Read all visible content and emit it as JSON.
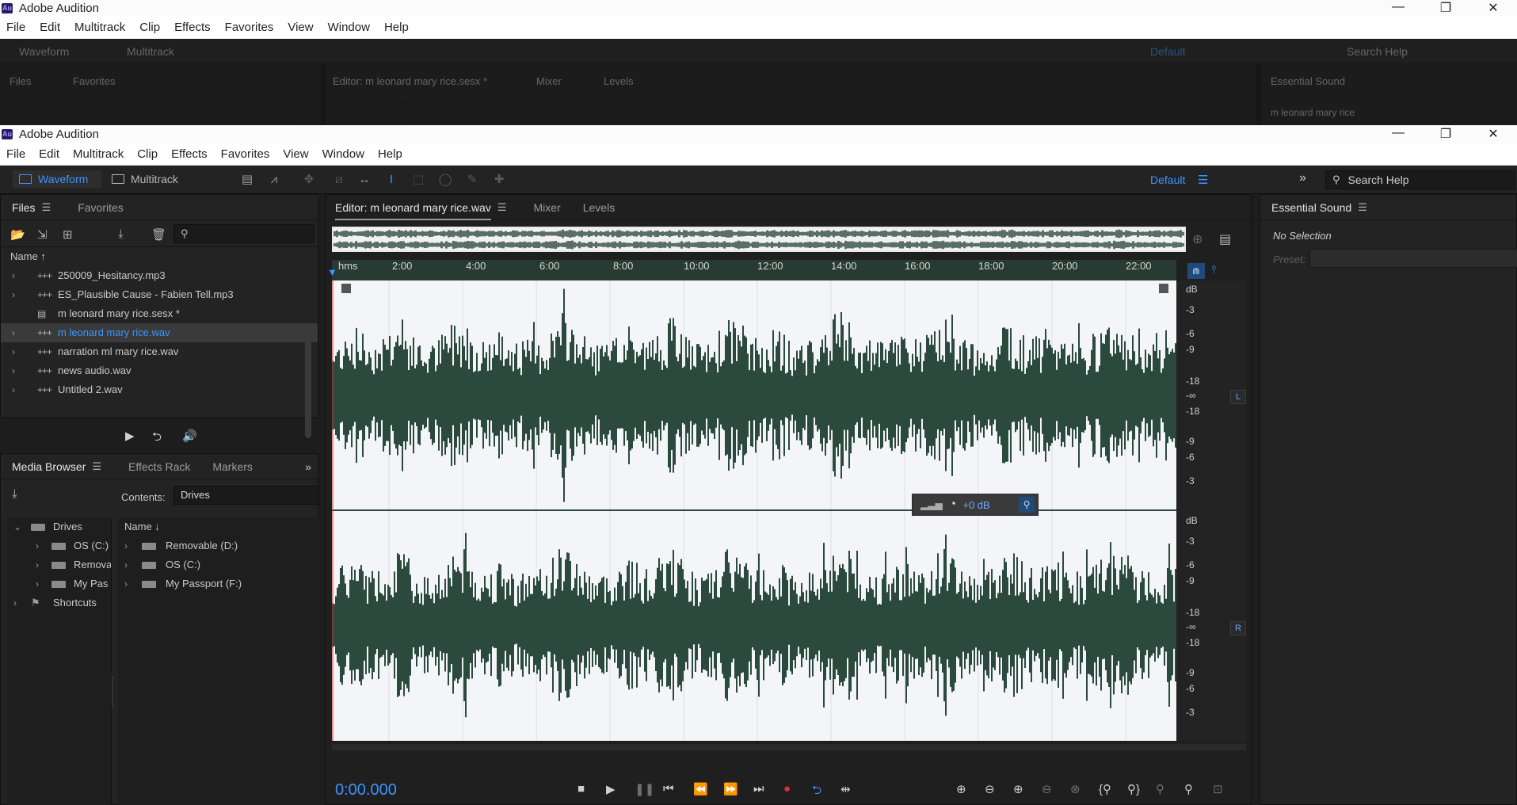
{
  "app": {
    "title": "Adobe Audition",
    "icon_text": "Au"
  },
  "window_controls": {
    "minimize": "—",
    "maximize": "❐",
    "close": "✕"
  },
  "menu": [
    "File",
    "Edit",
    "Multitrack",
    "Clip",
    "Effects",
    "Favorites",
    "View",
    "Window",
    "Help"
  ],
  "toolbar": {
    "waveform_label": "Waveform",
    "multitrack_label": "Multitrack",
    "workspace": "Default",
    "search_placeholder": "Search Help"
  },
  "background_window": {
    "editor_tab": "Editor: m leonard mary rice.sesx *",
    "mixer_tab": "Mixer",
    "levels_tab": "Levels",
    "files_tab": "Files",
    "favorites_tab": "Favorites",
    "essential_tab": "Essential Sound",
    "essential_sub": "m leonard mary rice"
  },
  "files_panel": {
    "tabs": {
      "files": "Files",
      "favorites": "Favorites"
    },
    "column_name": "Name",
    "items": [
      {
        "name": "250009_Hesitancy.mp3",
        "type": "audio"
      },
      {
        "name": "ES_Plausible Cause - Fabien Tell.mp3",
        "type": "audio"
      },
      {
        "name": "m leonard mary rice.sesx *",
        "type": "session"
      },
      {
        "name": "m leonard mary rice.wav",
        "type": "audio",
        "selected": true
      },
      {
        "name": "narration ml mary rice.wav",
        "type": "audio"
      },
      {
        "name": "news audio.wav",
        "type": "audio"
      },
      {
        "name": "Untitled 2.wav",
        "type": "audio"
      }
    ]
  },
  "media_panel": {
    "tabs": {
      "media_browser": "Media Browser",
      "effects_rack": "Effects Rack",
      "markers": "Markers"
    },
    "contents_label": "Contents:",
    "contents_value": "Drives",
    "tree": {
      "drives": "Drives",
      "os": "OS (C:)",
      "removable": "Remova",
      "passport": "My Pas",
      "shortcuts": "Shortcuts"
    },
    "column_name": "Name",
    "list": [
      "Removable (D:)",
      "OS (C:)",
      "My Passport (F:)"
    ]
  },
  "editor": {
    "tabs": {
      "editor": "Editor: m leonard mary rice.wav",
      "mixer": "Mixer",
      "levels": "Levels"
    },
    "timeline_ticks": [
      "hms",
      "2:00",
      "4:00",
      "6:00",
      "8:00",
      "10:00",
      "12:00",
      "14:00",
      "16:00",
      "18:00",
      "20:00",
      "22:00"
    ],
    "hud_gain": "+0 dB",
    "db_scale_top": [
      "dB",
      "-3",
      "-6",
      "-9",
      "-18",
      "-∞",
      "-18",
      "-9",
      "-6",
      "-3"
    ],
    "db_scale_bottom": [
      "dB",
      "-3",
      "-6",
      "-9",
      "-18",
      "-∞",
      "-18",
      "-9",
      "-6",
      "-3"
    ],
    "channel_left": "L",
    "channel_right": "R",
    "current_time": "0:00.000",
    "waveform_color": "#2b4a3d"
  },
  "essential_sound": {
    "title": "Essential Sound",
    "no_selection": "No Selection",
    "preset_label": "Preset:"
  },
  "colors": {
    "accent": "#3b95ff",
    "record": "#e03030"
  }
}
